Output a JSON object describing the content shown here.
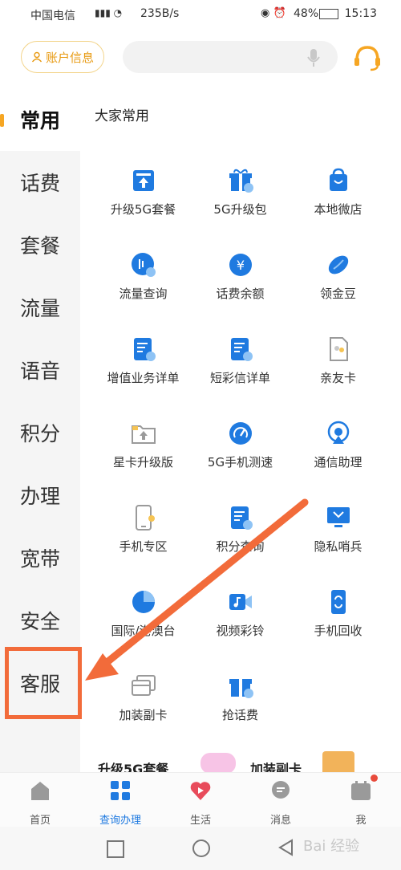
{
  "status_bar": {
    "carrier": "中国电信",
    "net_speed": "235B/s",
    "battery": "48%",
    "time": "15:13"
  },
  "header": {
    "account_label": "账户信息"
  },
  "sidebar": {
    "items": [
      "常用",
      "话费",
      "套餐",
      "流量",
      "语音",
      "积分",
      "办理",
      "宽带",
      "安全",
      "客服"
    ],
    "active_index": 0
  },
  "main": {
    "section_title": "大家常用",
    "items": [
      "升级5G套餐",
      "5G升级包",
      "本地微店",
      "流量查询",
      "话费余额",
      "领金豆",
      "增值业务详单",
      "短彩信详单",
      "亲友卡",
      "星卡升级版",
      "5G手机测速",
      "通信助理",
      "手机专区",
      "积分查询",
      "隐私哨兵",
      "国际/港澳台",
      "视频彩铃",
      "手机回收",
      "加装副卡",
      "抢话费"
    ],
    "promo": [
      "升级5G套餐",
      "加装副卡"
    ]
  },
  "tabbar": {
    "items": [
      "首页",
      "查询办理",
      "生活",
      "消息",
      "我"
    ],
    "active_index": 1
  },
  "colors": {
    "accent_orange": "#f6a623",
    "brand_blue": "#1f7ae0",
    "annotation": "#f26b3a"
  },
  "watermark": "Bai 经验"
}
